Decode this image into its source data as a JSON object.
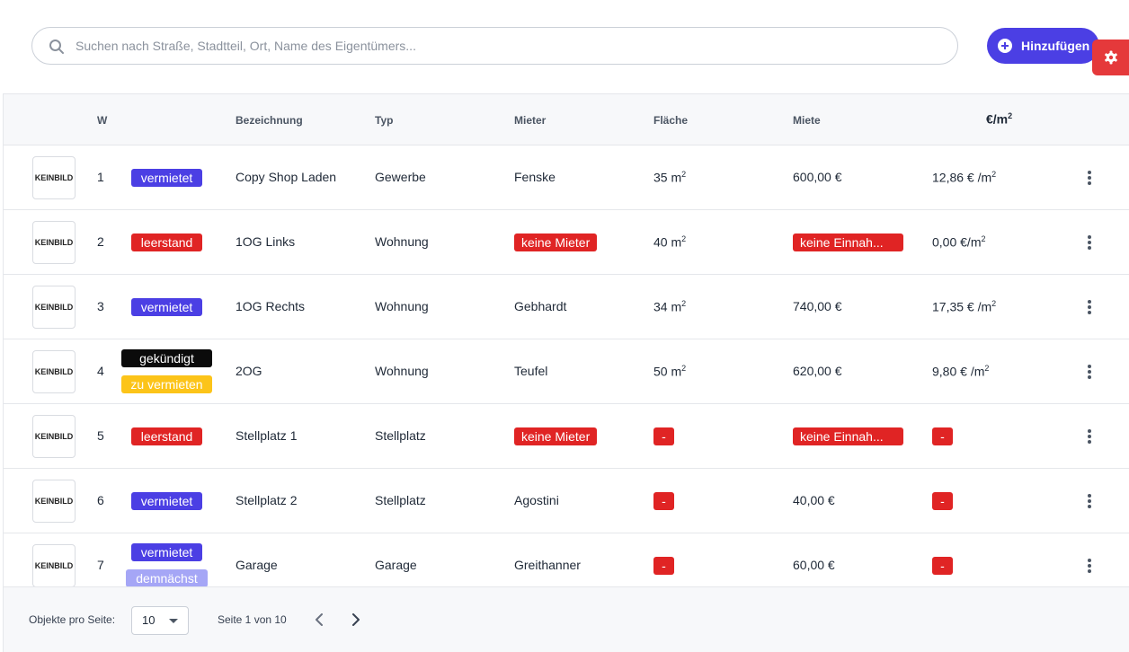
{
  "search": {
    "placeholder": "Suchen nach Straße, Stadtteil, Ort, Name des Eigentümers...",
    "value": ""
  },
  "toolbar": {
    "add_label": "Hinzufügen",
    "add_icon": "plus-circle-icon",
    "settings_icon": "gear-icon"
  },
  "colors": {
    "accent": "#4b3fe4",
    "danger": "#e02424",
    "warning": "#fcc419",
    "muted_badge": "#a5a6f6"
  },
  "table": {
    "headers": {
      "w": "W",
      "bezeichnung": "Bezeichnung",
      "typ": "Typ",
      "mieter": "Mieter",
      "flaeche": "Fläche",
      "miete": "Miete",
      "eur_m2": "€/m",
      "eur_m2_sup": "2"
    },
    "thumb_line1": "KEIN",
    "thumb_line2": "BILD",
    "rows": [
      {
        "w": "1",
        "status": [
          {
            "label": "vermietet",
            "kind": "blue"
          }
        ],
        "bezeichnung": "Copy Shop Laden",
        "typ": "Gewerbe",
        "mieter": "Fenske",
        "mieter_badge": false,
        "flaeche": "35 m",
        "flaeche_sup": "2",
        "flaeche_dash": false,
        "miete": "600,00 €",
        "miete_badge": false,
        "eur": "12,86 € /m",
        "eur_sup": "2",
        "eur_dash": false
      },
      {
        "w": "2",
        "status": [
          {
            "label": "leerstand",
            "kind": "red"
          }
        ],
        "bezeichnung": "1OG Links",
        "typ": "Wohnung",
        "mieter": "keine Mieter",
        "mieter_badge": true,
        "flaeche": "40 m",
        "flaeche_sup": "2",
        "flaeche_dash": false,
        "miete": "keine Einnah...",
        "miete_badge": true,
        "eur": "0,00 €/m",
        "eur_sup": "2",
        "eur_dash": false
      },
      {
        "w": "3",
        "status": [
          {
            "label": "vermietet",
            "kind": "blue"
          }
        ],
        "bezeichnung": "1OG Rechts",
        "typ": "Wohnung",
        "mieter": "Gebhardt",
        "mieter_badge": false,
        "flaeche": "34 m",
        "flaeche_sup": "2",
        "flaeche_dash": false,
        "miete": "740,00 €",
        "miete_badge": false,
        "eur": "17,35 € /m",
        "eur_sup": "2",
        "eur_dash": false
      },
      {
        "w": "4",
        "status": [
          {
            "label": "gekündigt",
            "kind": "black"
          },
          {
            "label": "zu vermieten",
            "kind": "yellow"
          }
        ],
        "bezeichnung": "2OG",
        "typ": "Wohnung",
        "mieter": "Teufel",
        "mieter_badge": false,
        "flaeche": "50 m",
        "flaeche_sup": "2",
        "flaeche_dash": false,
        "miete": "620,00 €",
        "miete_badge": false,
        "eur": "9,80 € /m",
        "eur_sup": "2",
        "eur_dash": false
      },
      {
        "w": "5",
        "status": [
          {
            "label": "leerstand",
            "kind": "red"
          }
        ],
        "bezeichnung": "Stellplatz 1",
        "typ": "Stellplatz",
        "mieter": "keine Mieter",
        "mieter_badge": true,
        "flaeche": "-",
        "flaeche_sup": "",
        "flaeche_dash": true,
        "miete": "keine Einnah...",
        "miete_badge": true,
        "eur": "-",
        "eur_sup": "",
        "eur_dash": true
      },
      {
        "w": "6",
        "status": [
          {
            "label": "vermietet",
            "kind": "blue"
          }
        ],
        "bezeichnung": "Stellplatz 2",
        "typ": "Stellplatz",
        "mieter": "Agostini",
        "mieter_badge": false,
        "flaeche": "-",
        "flaeche_sup": "",
        "flaeche_dash": true,
        "miete": "40,00 €",
        "miete_badge": false,
        "eur": "-",
        "eur_sup": "",
        "eur_dash": true
      },
      {
        "w": "7",
        "status": [
          {
            "label": "vermietet",
            "kind": "blue"
          },
          {
            "label": "demnächst",
            "kind": "lilac"
          }
        ],
        "bezeichnung": "Garage",
        "typ": "Garage",
        "mieter": "Greithanner",
        "mieter_badge": false,
        "flaeche": "-",
        "flaeche_sup": "",
        "flaeche_dash": true,
        "miete": "60,00 €",
        "miete_badge": false,
        "eur": "-",
        "eur_sup": "",
        "eur_dash": true
      }
    ]
  },
  "footer": {
    "per_page_label": "Objekte pro Seite:",
    "per_page_value": "10",
    "page_info": "Seite 1 von 10",
    "prev_icon": "chevron-left-icon",
    "next_icon": "chevron-right-icon"
  }
}
